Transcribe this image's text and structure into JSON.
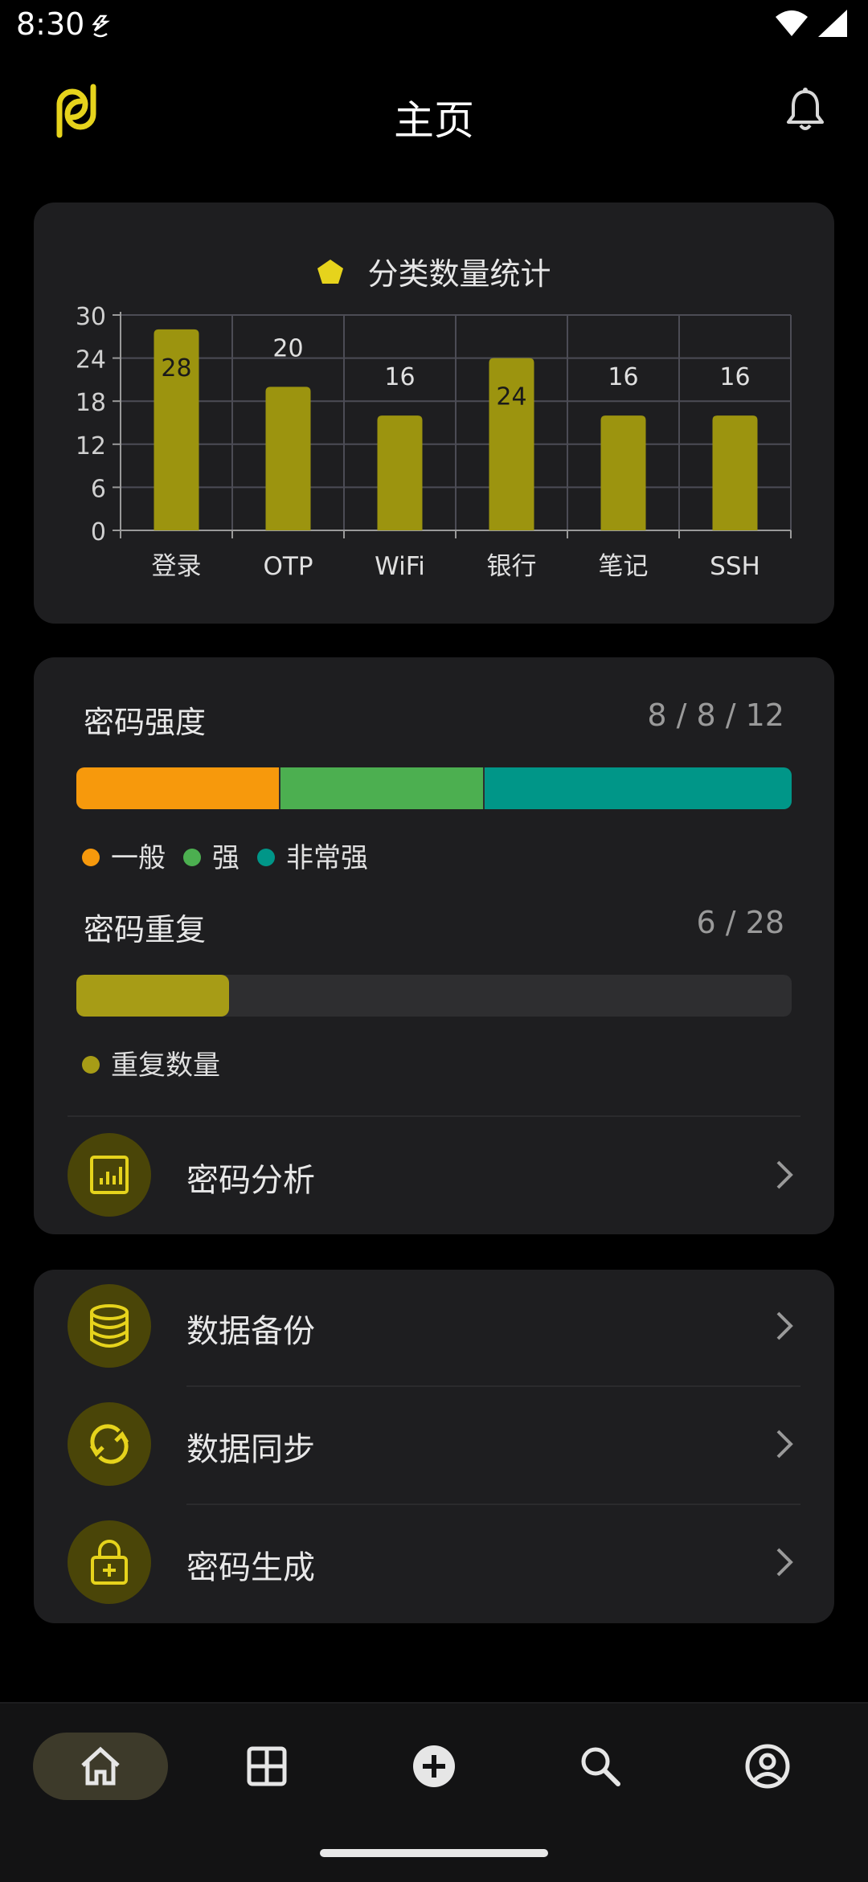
{
  "status": {
    "time": "8:30"
  },
  "header": {
    "title": "主页"
  },
  "chart_card": {
    "legend_label": "分类数量统计"
  },
  "chart_data": {
    "type": "bar",
    "categories": [
      "登录",
      "OTP",
      "WiFi",
      "银行",
      "笔记",
      "SSH"
    ],
    "values": [
      28,
      20,
      16,
      24,
      16,
      16
    ],
    "y_ticks": [
      0,
      6,
      12,
      18,
      24,
      30
    ],
    "ylim": [
      0,
      30
    ],
    "bar_color": "#9c940f",
    "grid": true
  },
  "strength": {
    "title": "密码强度",
    "value": "8 / 8 / 12",
    "segments": [
      {
        "label": "一般",
        "count": 8,
        "color": "#f7990c"
      },
      {
        "label": "强",
        "count": 8,
        "color": "#4caf50"
      },
      {
        "label": "非常强",
        "count": 12,
        "color": "#009688"
      }
    ]
  },
  "repeat": {
    "title": "密码重复",
    "value": "6 / 28",
    "fraction": 0.214,
    "legend": "重复数量",
    "color": "#a79c16"
  },
  "analysis": {
    "label": "密码分析"
  },
  "tools": [
    {
      "label": "数据备份",
      "icon": "database-icon"
    },
    {
      "label": "数据同步",
      "icon": "sync-icon"
    },
    {
      "label": "密码生成",
      "icon": "lock-plus-icon"
    }
  ],
  "nav": [
    "home-icon",
    "grid-icon",
    "add-circle-icon",
    "search-icon",
    "account-icon"
  ],
  "colors": {
    "accent": "#e6d31c",
    "icon_bg": "#4a4508"
  }
}
